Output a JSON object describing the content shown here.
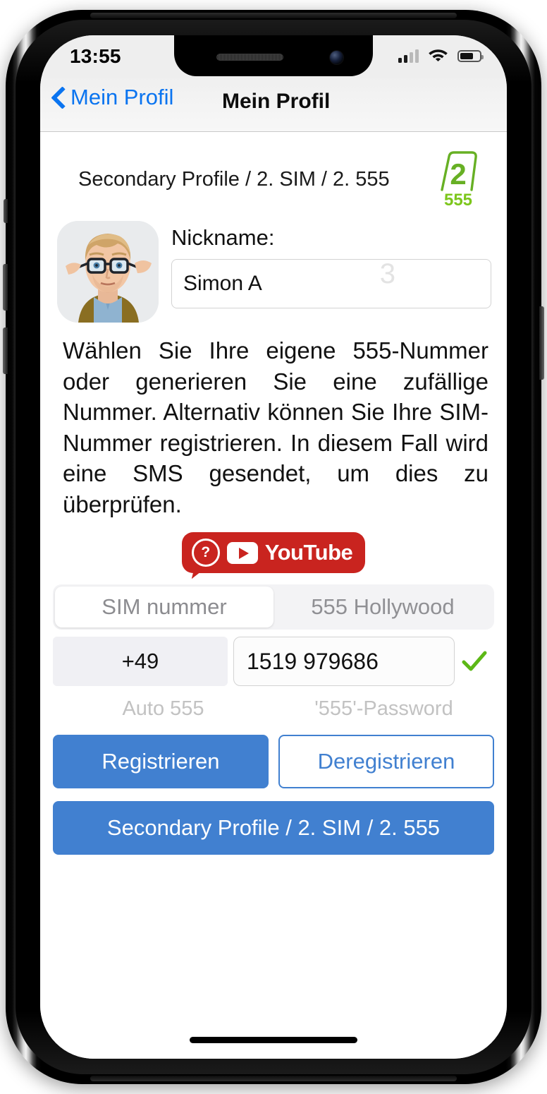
{
  "status_bar": {
    "time": "13:55",
    "signal_icon": "cellular-signal-icon",
    "signal_bars_filled": 2,
    "signal_bars_total": 4,
    "wifi_icon": "wifi-icon",
    "battery_icon": "battery-icon",
    "battery_level_percent": 60
  },
  "nav": {
    "back_icon": "chevron-left-icon",
    "back_label": "Mein Profil",
    "title": "Mein Profil"
  },
  "profile": {
    "header_title": "Secondary Profile / 2. SIM / 2. 555",
    "logo": {
      "icon": "sim-card-2-555-logo",
      "number": "2",
      "caption": "555",
      "color": "#67b024"
    },
    "avatar_icon": "user-avatar-photo",
    "nickname_label": "Nickname:",
    "nickname_value": "Simon A",
    "nickname_watermark": "3"
  },
  "description": "Wählen Sie Ihre eigene 555-Nummer oder generieren Sie eine zufällige Nummer. Alternativ können Sie Ihre SIM-Nummer registrieren. In diesem Fall wird eine SMS gesendet, um dies zu überprüfen.",
  "youtube_badge": {
    "help_icon": "question-mark-bubble-icon",
    "play_icon": "youtube-play-icon",
    "label": "YouTube",
    "color": "#c9241f"
  },
  "segmented_control": {
    "options": [
      {
        "label": "SIM nummer",
        "selected": true
      },
      {
        "label": "555 Hollywood",
        "selected": false
      }
    ]
  },
  "phone_input": {
    "country_code": "+49",
    "number": "1519 979686",
    "validation_icon": "green-check-icon",
    "validation_color": "#5cb816"
  },
  "sub_labels": {
    "left": "Auto 555",
    "right": "'555'-Password"
  },
  "buttons": {
    "register": "Registrieren",
    "deregister": "Deregistrieren",
    "secondary_profile": "Secondary Profile / 2. SIM / 2. 555",
    "primary_color": "#4180d0"
  },
  "home_indicator_icon": "home-indicator-bar"
}
